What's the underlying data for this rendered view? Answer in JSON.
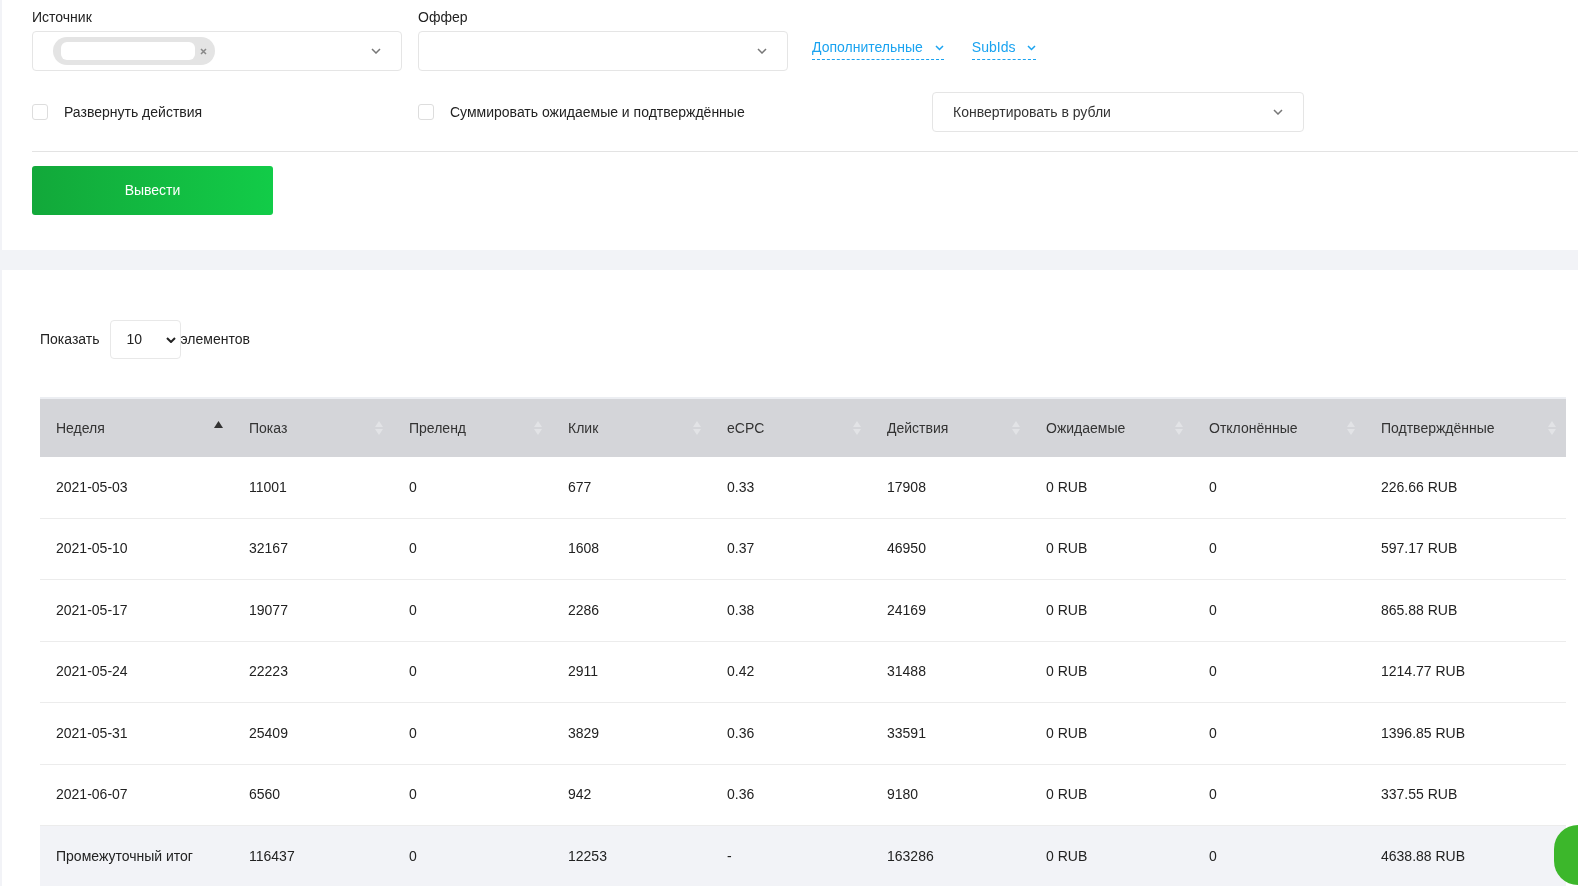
{
  "filters": {
    "source": {
      "label": "Источник",
      "has_selection": true
    },
    "offer": {
      "label": "Оффер"
    },
    "links": [
      "Дополнительные",
      "SubIds"
    ],
    "options": [
      {
        "label": "Развернуть действия",
        "checked": false
      },
      {
        "label": "Суммировать ожидаемые и подтверждённые",
        "checked": false
      }
    ],
    "currency": {
      "value": "Конвертировать в рубли"
    },
    "submit": "Вывести"
  },
  "length": {
    "prefix": "Показать",
    "value": "10",
    "suffix": "элементов"
  },
  "table": {
    "columns": [
      {
        "label": "Неделя",
        "sorted": true
      },
      {
        "label": "Показ",
        "sorted": false
      },
      {
        "label": "Преленд",
        "sorted": false
      },
      {
        "label": "Клик",
        "sorted": false
      },
      {
        "label": "eCPC",
        "sorted": false
      },
      {
        "label": "Действия",
        "sorted": false
      },
      {
        "label": "Ожидаемые",
        "sorted": false
      },
      {
        "label": "Отклонённые",
        "sorted": false
      },
      {
        "label": "Подтверждённые",
        "sorted": false
      }
    ],
    "rows": [
      {
        "kind": "data",
        "cells": [
          "2021-05-03",
          "11001",
          "0",
          "677",
          "0.33",
          "17908",
          "0 RUB",
          "0",
          "226.66 RUB"
        ]
      },
      {
        "kind": "data",
        "cells": [
          "2021-05-10",
          "32167",
          "0",
          "1608",
          "0.37",
          "46950",
          "0 RUB",
          "0",
          "597.17 RUB"
        ]
      },
      {
        "kind": "data",
        "cells": [
          "2021-05-17",
          "19077",
          "0",
          "2286",
          "0.38",
          "24169",
          "0 RUB",
          "0",
          "865.88 RUB"
        ]
      },
      {
        "kind": "data",
        "cells": [
          "2021-05-24",
          "22223",
          "0",
          "2911",
          "0.42",
          "31488",
          "0 RUB",
          "0",
          "1214.77 RUB"
        ]
      },
      {
        "kind": "data",
        "cells": [
          "2021-05-31",
          "25409",
          "0",
          "3829",
          "0.36",
          "33591",
          "0 RUB",
          "0",
          "1396.85 RUB"
        ]
      },
      {
        "kind": "data",
        "cells": [
          "2021-06-07",
          "6560",
          "0",
          "942",
          "0.36",
          "9180",
          "0 RUB",
          "0",
          "337.55 RUB"
        ]
      },
      {
        "kind": "subtotal",
        "cells": [
          "Промежуточный итог",
          "116437",
          "0",
          "12253",
          "-",
          "163286",
          "0 RUB",
          "0",
          "4638.88 RUB"
        ]
      }
    ]
  },
  "chat_button": {
    "visible": true
  }
}
